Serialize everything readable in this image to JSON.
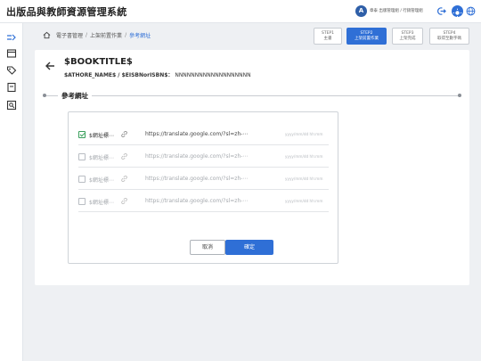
{
  "app": {
    "title": "出版品與教師資源管理系統"
  },
  "user": {
    "avatar_initial": "A",
    "name": "章泰 出版管理組 / 行銷管理組"
  },
  "breadcrumb": [
    "電子書管理",
    "上架前置作業",
    "參考網址"
  ],
  "steps": [
    {
      "line1": "STEP1",
      "line2": "主書"
    },
    {
      "line1": "STEP2",
      "line2": "上架前置作業"
    },
    {
      "line1": "STEP3",
      "line2": "上架完成"
    },
    {
      "line1": "STEP4",
      "line2": "取得至數字碼"
    }
  ],
  "steps_active_index": 1,
  "book": {
    "title": "$BOOKTITLE$",
    "meta_label": "$ATHORE_NAME$ / $EISBNorISBN$：",
    "meta_value": "NNNNNNNNNNNNNNNNNNN"
  },
  "section": {
    "title": "參考網址"
  },
  "references": [
    {
      "label": "$網址標⋯",
      "url": "https://translate.google.com/?sl=zh-⋯",
      "date": "yyyy/mm/dd hh:mm",
      "checked": true,
      "enabled": true
    },
    {
      "label": "$網址標⋯",
      "url": "https://translate.google.com/?sl=zh-⋯",
      "date": "yyyy/mm/dd hh:mm",
      "checked": false,
      "enabled": false
    },
    {
      "label": "$網址標⋯",
      "url": "https://translate.google.com/?sl=zh-⋯",
      "date": "yyyy/mm/dd hh:mm",
      "checked": false,
      "enabled": false
    },
    {
      "label": "$網址標⋯",
      "url": "https://translate.google.com/?sl=zh-⋯",
      "date": "yyyy/mm/dd hh:mm",
      "checked": false,
      "enabled": false
    }
  ],
  "actions": {
    "cancel": "取消",
    "confirm": "確定"
  },
  "colors": {
    "accent": "#2f6fd6",
    "check": "#3aa05c"
  }
}
